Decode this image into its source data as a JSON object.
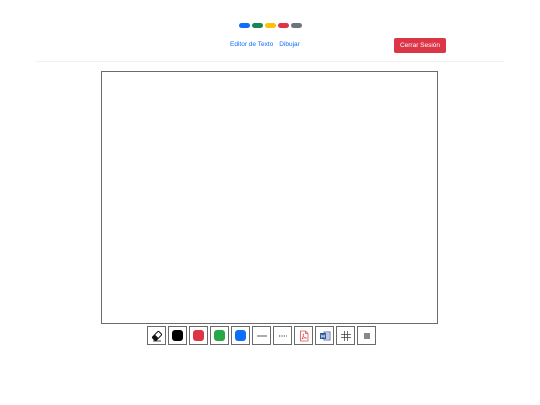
{
  "logo": {
    "colors": [
      "#0d6efd",
      "#198754",
      "#ffc107",
      "#dc3545",
      "#6c757d"
    ]
  },
  "nav": {
    "links": [
      {
        "label": "Editor de Texto"
      },
      {
        "label": "Dibujar"
      }
    ]
  },
  "header": {
    "logout_label": "Cerrar Sesión"
  },
  "toolbar": {
    "tools": [
      {
        "icon": "eraser-icon"
      },
      {
        "icon": "color-black-icon",
        "color": "#000000"
      },
      {
        "icon": "color-red-icon",
        "color": "#dc3545"
      },
      {
        "icon": "color-green-icon",
        "color": "#28a745"
      },
      {
        "icon": "color-blue-icon",
        "color": "#0d6efd"
      },
      {
        "icon": "solid-line-icon"
      },
      {
        "icon": "dotted-line-icon"
      },
      {
        "icon": "pdf-icon"
      },
      {
        "icon": "word-icon"
      },
      {
        "icon": "grid-icon"
      },
      {
        "icon": "menu-icon"
      }
    ]
  }
}
